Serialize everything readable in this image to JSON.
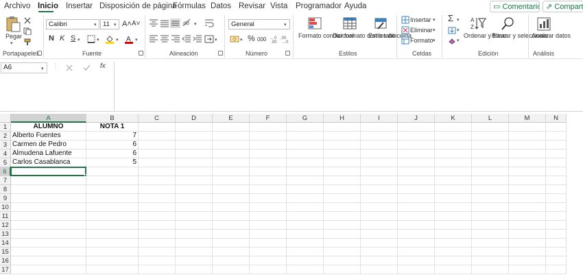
{
  "menu": {
    "tabs": [
      "Archivo",
      "Inicio",
      "Insertar",
      "Disposición de página",
      "Fórmulas",
      "Datos",
      "Revisar",
      "Vista",
      "Programador",
      "Ayuda"
    ],
    "active_tab": "Inicio",
    "comments_label": "Comentarios",
    "share_label": "Compartir"
  },
  "ribbon": {
    "clipboard": {
      "paste_label": "Pegar",
      "group_label": "Portapapeles"
    },
    "font": {
      "font_name": "Calibri",
      "font_size": "11",
      "bold": "N",
      "italic": "K",
      "underline": "S",
      "grow": "A˄",
      "shrink": "A˅",
      "group_label": "Fuente"
    },
    "alignment": {
      "group_label": "Alineación"
    },
    "number": {
      "format": "General",
      "percent": "%",
      "thousands": "000",
      "group_label": "Número"
    },
    "styles": {
      "conditional_label": "Formato condicional",
      "table_label": "Dar formato como tabla",
      "cell_styles_label": "Estilos de celda",
      "group_label": "Estilos"
    },
    "cells": {
      "insert_label": "Insertar",
      "delete_label": "Eliminar",
      "format_label": "Formato",
      "group_label": "Celdas"
    },
    "editing": {
      "sort_label": "Ordenar y filtrar",
      "find_label": "Buscar y seleccionar",
      "group_label": "Edición"
    },
    "analysis": {
      "analyze_label": "Analizar datos",
      "group_label": "Análisis"
    }
  },
  "formula_bar": {
    "name_box": "A6",
    "fx": "fx",
    "formula": ""
  },
  "sheet": {
    "columns": [
      "A",
      "B",
      "C",
      "D",
      "E",
      "F",
      "G",
      "H",
      "I",
      "J",
      "K",
      "L",
      "M",
      "N"
    ],
    "rows": [
      "1",
      "2",
      "3",
      "4",
      "5",
      "6",
      "7",
      "8",
      "9",
      "10",
      "11",
      "12",
      "13",
      "14",
      "15",
      "16",
      "17"
    ],
    "active_cell": "A6",
    "cells": {
      "A1": "ALUMNO",
      "B1": "NOTA 1",
      "A2": "Alberto Fuentes",
      "B2": "7",
      "A3": "Carmen de Pedro",
      "B3": "6",
      "A4": "Almudena Lafuente",
      "B4": "6",
      "A5": "Carlos Casablanca",
      "B5": "5"
    }
  },
  "colors": {
    "accent": "#217346"
  }
}
